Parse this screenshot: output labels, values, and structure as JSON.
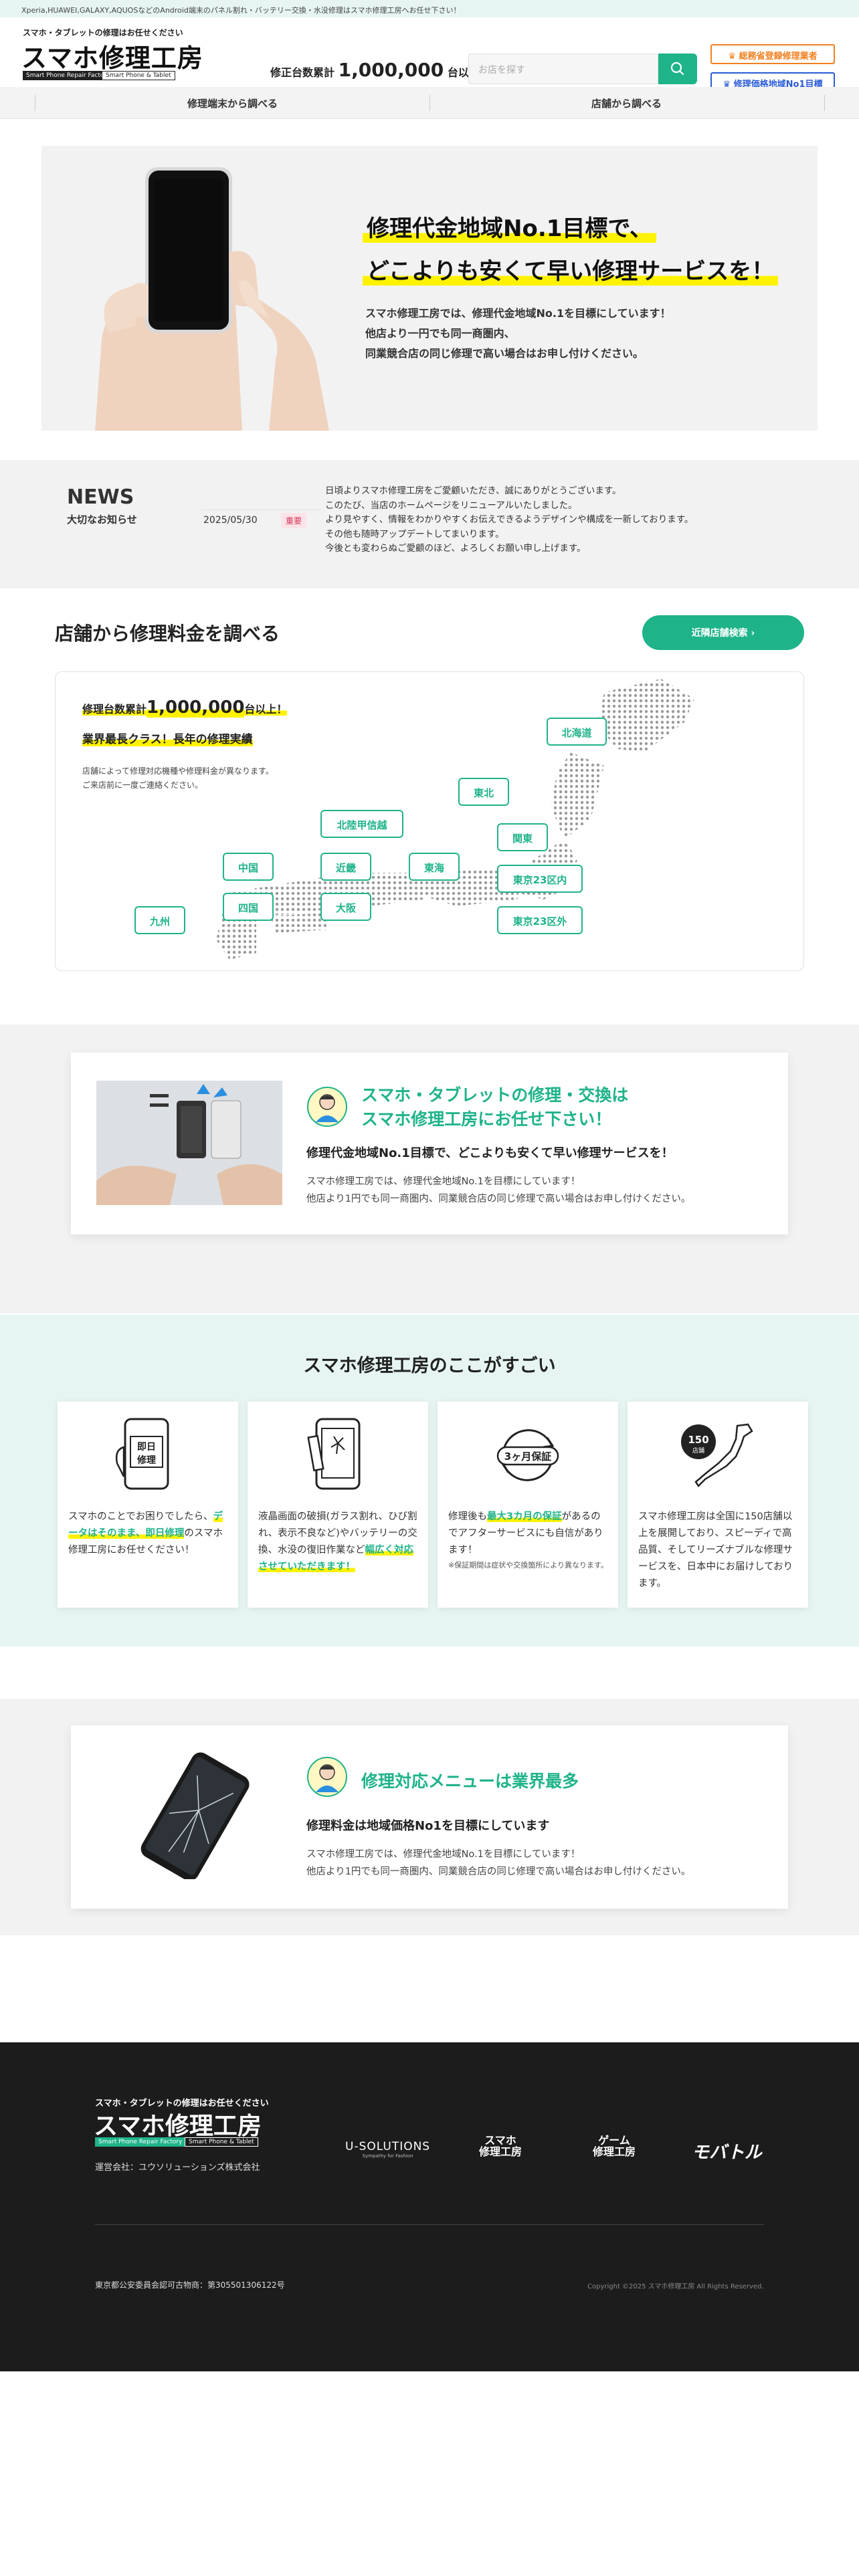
{
  "topbar": {
    "text": "Xperia,HUAWEI,GALAXY,AQUOSなどのAndroid端末のパネル割れ・バッテリー交換・水没修理はスマホ修理工房へお任せ下さい！"
  },
  "header": {
    "logo_tagline": "スマホ・タブレットの修理はお任せください",
    "logo_name": "スマホ修理工房",
    "logo_en1": "Smart Phone Repair Factory",
    "logo_en2": "Smart Phone & Tablet",
    "counter_prefix": "修正台数累計",
    "counter_value": "1,000,000",
    "counter_suffix": "台以上！",
    "search_placeholder": "お店を探す",
    "badge1": "総務省登録修理業者",
    "badge2": "修理価格地域No1目標"
  },
  "nav": {
    "item1": "修理端末から調べる",
    "item2": "店舗から調べる"
  },
  "hero": {
    "line1": "修理代金地域No.1目標で、",
    "line2": "どこよりも安くて早い修理サービスを！",
    "p1": "スマホ修理工房では、修理代金地域No.1を目標にしています！",
    "p2": "他店より一円でも同一商圏内、",
    "p3": "同業競合店の同じ修理で高い場合はお申し付けください。"
  },
  "news": {
    "title": "NEWS",
    "subtitle": "大切なお知らせ",
    "date": "2025/05/30",
    "tag": "重要",
    "lines": [
      "日頃よりスマホ修理工房をご愛顧いただき、誠にありがとうございます。",
      "このたび、当店のホームページをリニューアルいたしました。",
      "より見やすく、情報をわかりやすくお伝えできるようデザインや構成を一新しております。",
      "その他も随時アップデートしてまいります。",
      "今後とも変わらぬご愛顧のほど、よろしくお願い申し上げます。"
    ]
  },
  "stores": {
    "title": "店舗から修理料金を調べる",
    "near_button": "近隣店舗検索",
    "count_prefix": "修理台数累計",
    "count_value": "1,000,000",
    "count_suffix": "台以上！",
    "class_text": "業界最長クラス！長年の修理実績",
    "note1": "店舗によって修理対応機種や修理料金が異なります。",
    "note2": "ご来店前に一度ご連絡ください。",
    "regions": [
      "北海道",
      "東北",
      "北陸甲信越",
      "関東",
      "中国",
      "近畿",
      "東海",
      "東京23区内",
      "四国",
      "大阪",
      "東京23区外",
      "九州"
    ]
  },
  "repair_card": {
    "title1": "スマホ・タブレットの修理・交換は",
    "title2": "スマホ修理工房にお任せ下さい！",
    "heading": "修理代金地域No.1目標で、どこよりも安くて早い修理サービスを！",
    "p1": "スマホ修理工房では、修理代金地域No.1を目標にしています！",
    "p2": "他店より1円でも同一商圏内、同業競合店の同じ修理で高い場合はお申し付けください。"
  },
  "features": {
    "title": "スマホ修理工房のここがすごい",
    "card1": {
      "icon_label1": "即日",
      "icon_label2": "修理",
      "t1": "スマホのことでお困りでしたら、",
      "hl1": "データはそのまま、即日修理",
      "t2": "のスマホ修理工房にお任せください！"
    },
    "card2": {
      "t1": "液晶画面の破損(ガラス割れ、ひび割れ、表示不良など)やバッテリーの交換、水没の復旧作業など",
      "hl1": "幅広く対応させていただきます！"
    },
    "card3": {
      "icon_label": "3ヶ月保証",
      "t1": "修理後も",
      "hl1": "最大3カ月の保証",
      "t2": "があるのでアフターサービスにも自信があります！",
      "note": "※保証期間は症状や交換箇所により異なります。"
    },
    "card4": {
      "icon_num": "150",
      "icon_label": "店舗",
      "t1": "スマホ修理工房は全国に150店舗以上を展開しており、スピーディで高品質、そしてリーズナブルな修理サービスを、日本中にお届けしております。"
    }
  },
  "menu_card": {
    "title": "修理対応メニューは業界最多",
    "heading": "修理料金は地域価格No1を目標にしています",
    "p1": "スマホ修理工房では、修理代金地域No.1を目標にしています！",
    "p2": "他店より1円でも同一商圏内、同業競合店の同じ修理で高い場合はお申し付けください。"
  },
  "footer": {
    "logo_tagline": "スマホ・タブレットの修理はお任せください",
    "logo_name": "スマホ修理工房",
    "logo_en1": "Smart Phone Repair Factory",
    "logo_en2": "Smart Phone & Tablet",
    "company": "運営会社：ユウソリューションズ株式会社",
    "brand1": "U-SOLUTIONS",
    "brand1_sub": "Sympathy for Fashion",
    "brand2a": "スマホ",
    "brand2b": "修理工房",
    "brand3a": "ゲーム",
    "brand3b": "修理工房",
    "brand4": "モバトル",
    "license": "東京都公安委員会認可古物商：第305501306122号",
    "copyright": "Copyright ©2025 スマホ修理工房 All Rights Reserved."
  },
  "colors": {
    "green": "#1fb38a",
    "yellow": "#fff200",
    "orange": "#f08020",
    "blue": "#2a5bd7",
    "footer_bg": "#1c1c1c"
  }
}
